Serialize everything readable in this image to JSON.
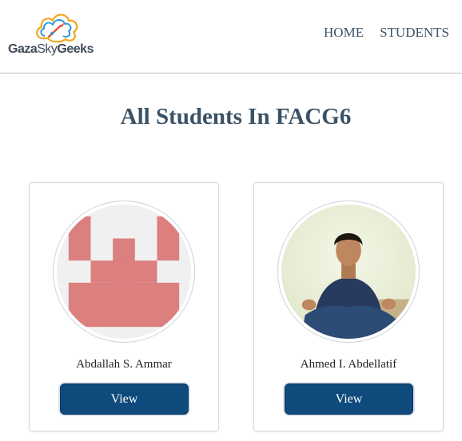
{
  "header": {
    "logo": {
      "text_bold_1": "Gaza",
      "text_light": "Sky",
      "text_bold_2": "Geeks"
    },
    "nav": [
      {
        "label": "HOME"
      },
      {
        "label": "STUDENTS"
      }
    ]
  },
  "main": {
    "title": "All Students In FACG6",
    "students": [
      {
        "name": "Abdallah S. Ammar",
        "button_label": "View",
        "avatar": "identicon-avatar"
      },
      {
        "name": "Ahmed I. Abdellatif",
        "button_label": "View",
        "avatar": "photo-avatar"
      }
    ]
  },
  "colors": {
    "accent": "#0f4a7d",
    "title": "#3a5266",
    "identicon": "#dc7f7f"
  }
}
